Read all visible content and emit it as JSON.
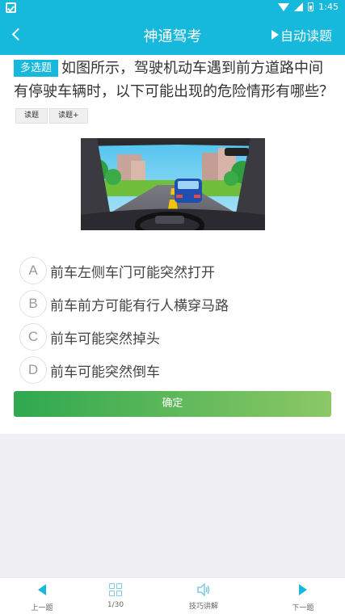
{
  "status_bar": {
    "time": "1:45"
  },
  "app_bar": {
    "title": "神通驾考",
    "auto_read_label": "自动读题"
  },
  "question": {
    "type_tag": "多选题",
    "text": "如图所示，驾驶机动车遇到前方道路中间有停驶车辆时，以下可能出现的危险情形有哪些？",
    "read_button": "读题",
    "read_plus_button": "读题+"
  },
  "options": [
    {
      "letter": "A",
      "text": "前车左侧车门可能突然打开"
    },
    {
      "letter": "B",
      "text": "前车前方可能有行人横穿马路"
    },
    {
      "letter": "C",
      "text": "前车可能突然掉头"
    },
    {
      "letter": "D",
      "text": "前车可能突然倒车"
    }
  ],
  "confirm_label": "确定",
  "bottom_bar": {
    "prev_label": "上一题",
    "progress_label": "1/30",
    "tips_label": "技巧讲解",
    "next_label": "下一题"
  },
  "colors": {
    "primary": "#16b8dc",
    "confirm_start": "#2fa84f",
    "confirm_end": "#8cc866"
  }
}
